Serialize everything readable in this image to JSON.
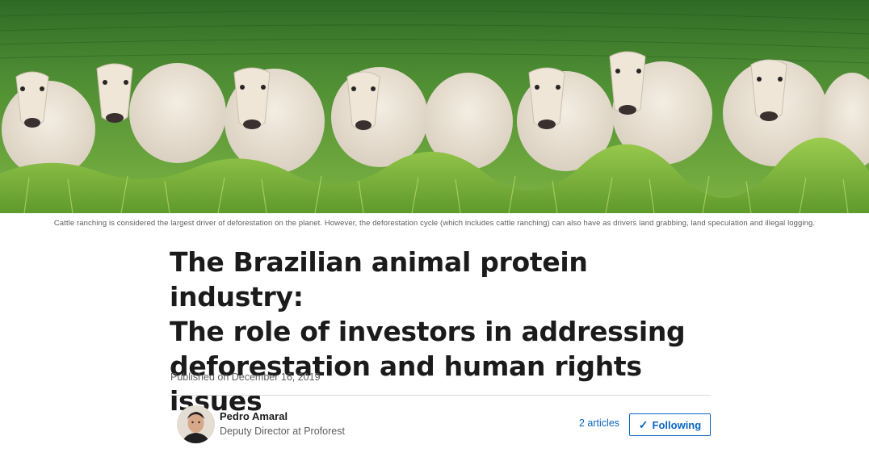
{
  "hero": {
    "image": "cattle-herd-photo",
    "caption": "Cattle ranching is considered the largest driver of deforestation on the planet. However, the deforestation cycle (which includes cattle ranching) can also have as drivers land grabbing, land speculation and illegal logging."
  },
  "article": {
    "title_line1": "The Brazilian animal protein industry:",
    "title_line2": "The role of investors in addressing",
    "title_line3": "deforestation and human rights issues",
    "published": "Published on December 16, 2019"
  },
  "author": {
    "name": "Pedro Amaral",
    "role": "Deputy Director at Proforest",
    "articles_link": "2 articles",
    "follow_label": "Following",
    "follow_icon": "check-icon"
  },
  "colors": {
    "accent": "#0a66c2",
    "text": "#1b1b1b",
    "muted": "#5e5e5e"
  }
}
